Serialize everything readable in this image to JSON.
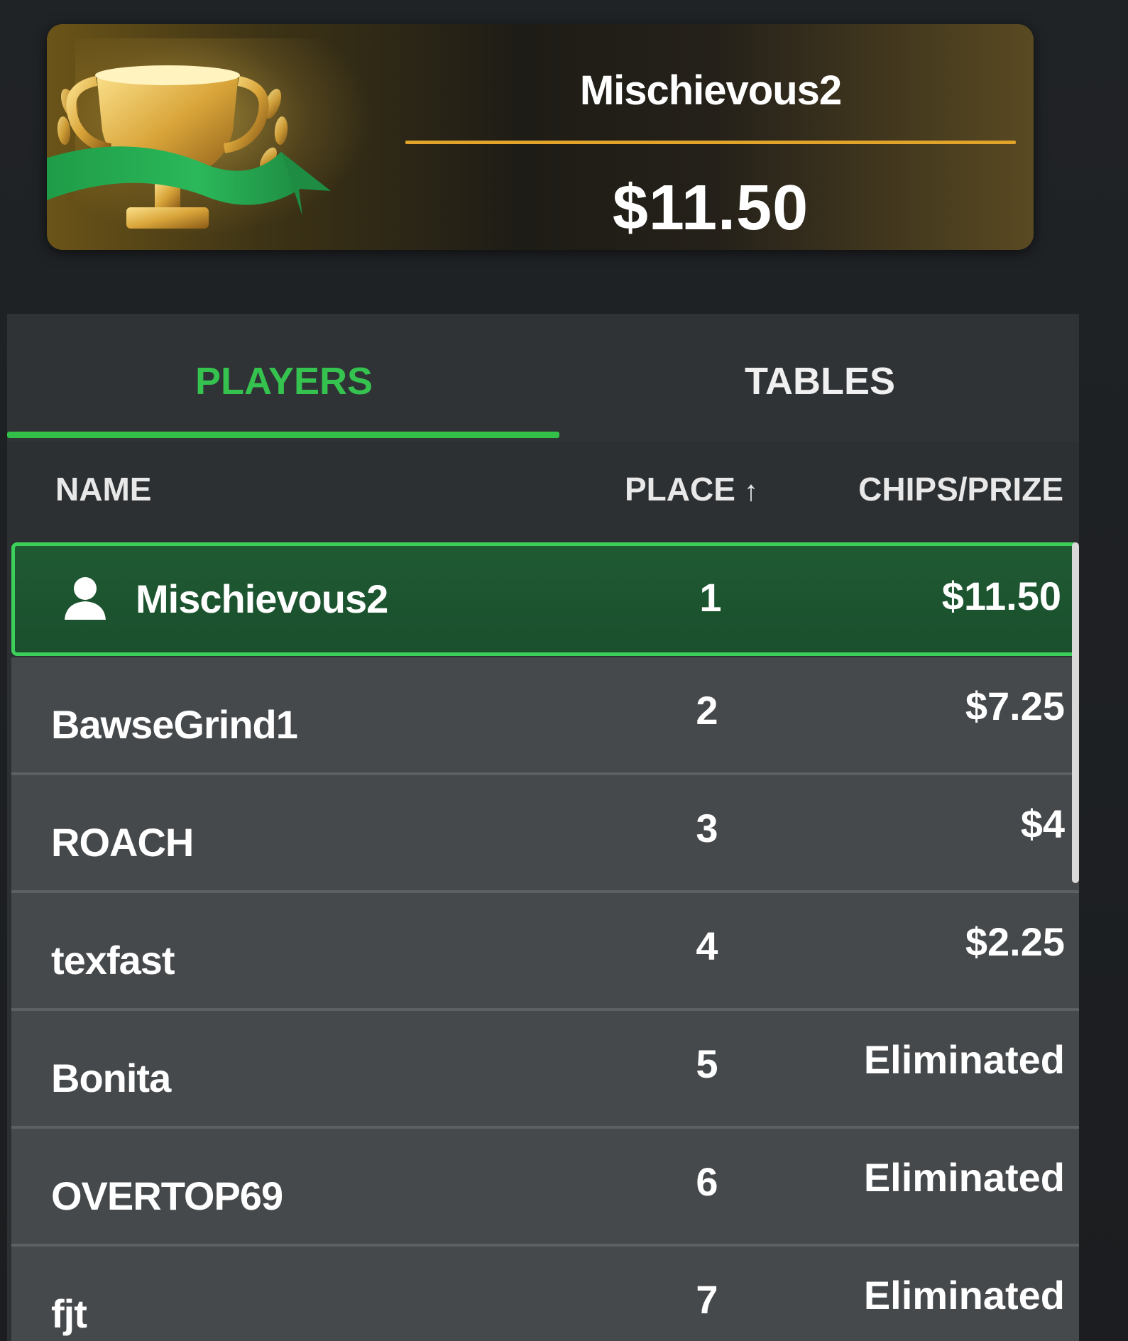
{
  "banner": {
    "winner_name": "Mischievous2",
    "winner_amount": "$11.50",
    "colors": {
      "divider": "#e2a32a",
      "ribbon": "#2bb85a",
      "gold": "#d9a53a"
    }
  },
  "tabs": [
    {
      "label": "PLAYERS",
      "active": true
    },
    {
      "label": "TABLES",
      "active": false
    }
  ],
  "columns": {
    "name": "NAME",
    "place": "PLACE",
    "place_sort_icon": "↑",
    "chips": "CHIPS/PRIZE"
  },
  "players": [
    {
      "name": "Mischievous2",
      "place": "1",
      "prize": "$11.50",
      "is_current_user": true
    },
    {
      "name": "BawseGrind1",
      "place": "2",
      "prize": "$7.25"
    },
    {
      "name": "ROACH",
      "place": "3",
      "prize": "$4"
    },
    {
      "name": "texfast",
      "place": "4",
      "prize": "$2.25"
    },
    {
      "name": "Bonita",
      "place": "5",
      "prize": "Eliminated"
    },
    {
      "name": "OVERTOP69",
      "place": "6",
      "prize": "Eliminated"
    },
    {
      "name": "fjt",
      "place": "7",
      "prize": "Eliminated"
    }
  ],
  "theme": {
    "accent_green": "#35c24e",
    "row_bg": "#46494b",
    "highlight_row_bg": "#1f5a33"
  }
}
